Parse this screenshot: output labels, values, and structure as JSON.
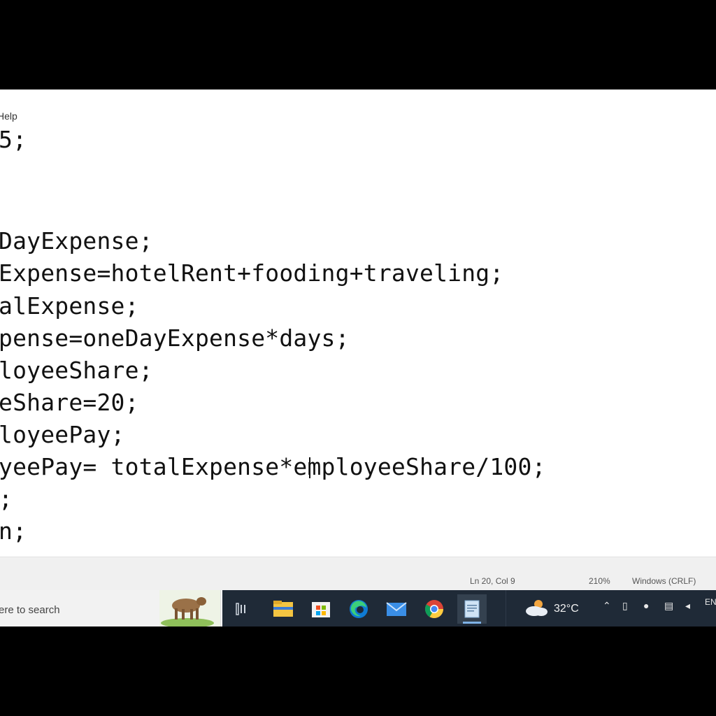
{
  "menubar": {
    "help_label": "Help"
  },
  "editor": {
    "lines": [
      "5;",
      "",
      "",
      "DayExpense;",
      "Expense=hotelRent+fooding+traveling;",
      "alExpense;",
      "pense=oneDayExpense*days;",
      "loyeeShare;",
      "eShare=20;",
      "loyeePay;",
      "yeePay= totalExpense*employeeShare/100;",
      ";",
      "n;"
    ]
  },
  "statusbar": {
    "position": "Ln 20, Col 9",
    "zoom": "210%",
    "line_ending": "Windows (CRLF)"
  },
  "taskbar": {
    "search_placeholder": "ere to search",
    "apps": [
      {
        "name": "task-view-icon"
      },
      {
        "name": "file-explorer-icon"
      },
      {
        "name": "store-icon"
      },
      {
        "name": "edge-icon"
      },
      {
        "name": "mail-icon"
      },
      {
        "name": "chrome-icon"
      },
      {
        "name": "notepad-icon"
      }
    ],
    "weather_temp": "32°C",
    "language_partial": "EN"
  },
  "colors": {
    "taskbar_dark": "#1f2a37",
    "accent_blue": "#7fb2e6"
  }
}
